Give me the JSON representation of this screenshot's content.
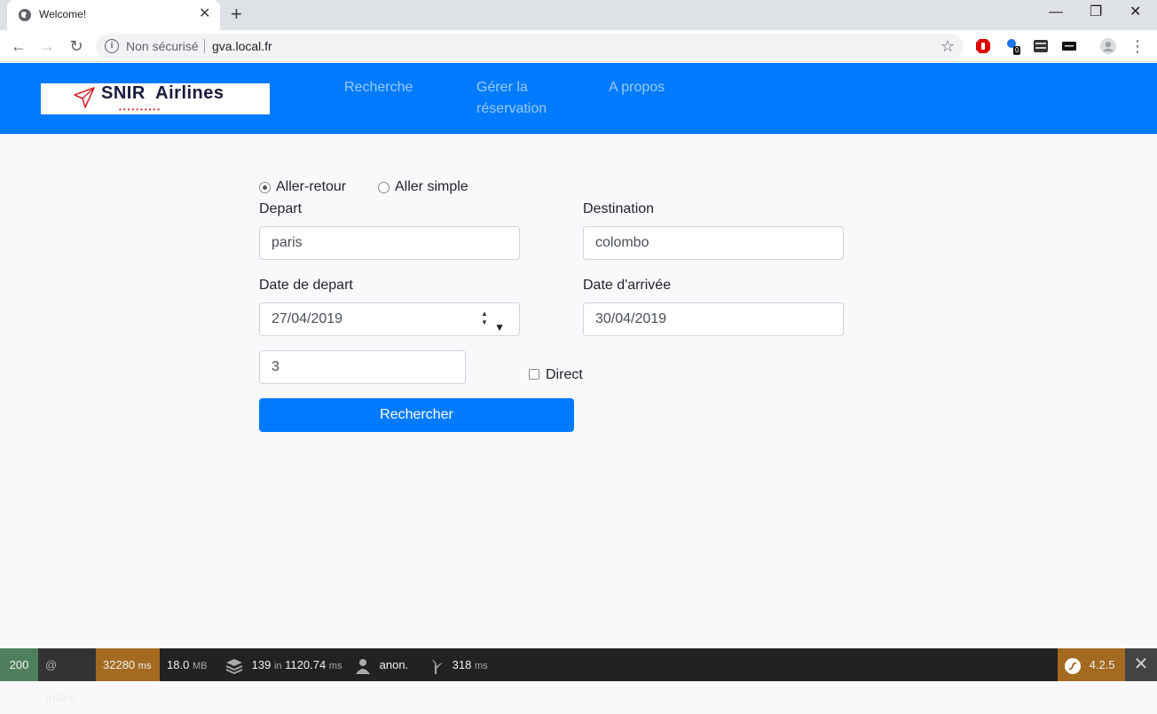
{
  "browser": {
    "tab_title": "Welcome!",
    "tab_close": "✕",
    "new_tab": "+",
    "minimize": "—",
    "restore": "❐",
    "close": "✕",
    "not_secure": "Non sécurisé",
    "url": "gva.local.fr",
    "extension_badge": "0"
  },
  "navbar": {
    "logo_text": "SNIR  Airlines",
    "logo_dots": "••••••••••",
    "links": [
      "Recherche",
      "Gérer la",
      "réservation",
      "A propos"
    ]
  },
  "form": {
    "trip_types": [
      "Aller-retour",
      "Aller simple"
    ],
    "selected_trip_type": "Aller-retour",
    "depart_label": "Depart",
    "depart_value": "paris",
    "destination_label": "Destination",
    "destination_value": "colombo",
    "date_depart_label": "Date de depart",
    "date_depart_value": "27/04/2019",
    "date_arrivee_label": "Date d'arrivée",
    "date_arrivee_value": "30/04/2019",
    "passengers_value": "3",
    "direct_label": "Direct",
    "submit_label": "Rechercher"
  },
  "debug_toolbar": {
    "status": "200",
    "route_prefix": "@",
    "route": "index",
    "time": "32280",
    "time_unit": "ms",
    "memory": "18.0",
    "memory_unit": "MB",
    "db_queries": "139",
    "db_in": "in",
    "db_time": "1120.74",
    "db_unit": "ms",
    "user": "anon.",
    "twig_time": "318",
    "twig_unit": "ms",
    "version": "4.2.5",
    "colors": {
      "status_bg": "#4f805d",
      "time_bg": "#a46a1f",
      "version_bg": "#a46a1f"
    }
  }
}
